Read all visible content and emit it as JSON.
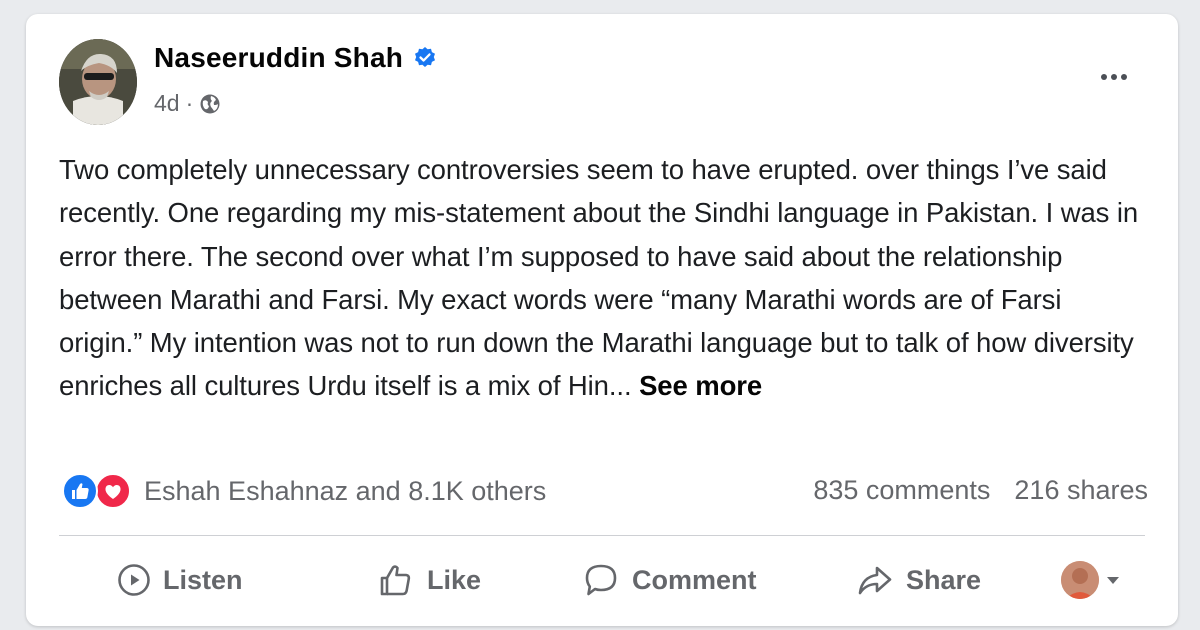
{
  "post": {
    "author": "Naseeruddin Shah",
    "time": "4d",
    "separator": "·",
    "text": "Two completely unnecessary controversies seem to have erupted. over things I’ve said recently. One regarding my mis-statement about the Sindhi language in Pakistan. I was in error there. The second over what I’m supposed to have said about the relationship between Marathi and Farsi. My exact words were “many  Marathi words are of Farsi origin.” My intention was not to run down the Marathi language but to talk of how diversity enriches all cultures  Urdu itself is a mix of Hin...",
    "see_more": "See more"
  },
  "icons": {
    "verified": "verified-badge-icon",
    "privacy": "globe-icon",
    "more": "more-options-icon",
    "reaction_like": "like-reaction-icon",
    "reaction_love": "love-reaction-icon",
    "listen": "play-circle-icon",
    "like": "thumbs-up-icon",
    "comment": "comment-bubble-icon",
    "share": "share-arrow-icon",
    "dropdown": "caret-down-icon"
  },
  "stats": {
    "reactions_text": "Eshah Eshahnaz and 8.1K others",
    "comments": "835 comments",
    "shares": "216 shares"
  },
  "actions": {
    "listen": "Listen",
    "like": "Like",
    "comment": "Comment",
    "share": "Share"
  },
  "colors": {
    "verified": "#1877f2",
    "like_reaction": "#1877f2",
    "love_reaction": "#f0284a",
    "secondary_text": "#65676b",
    "primary_text": "#050505"
  }
}
